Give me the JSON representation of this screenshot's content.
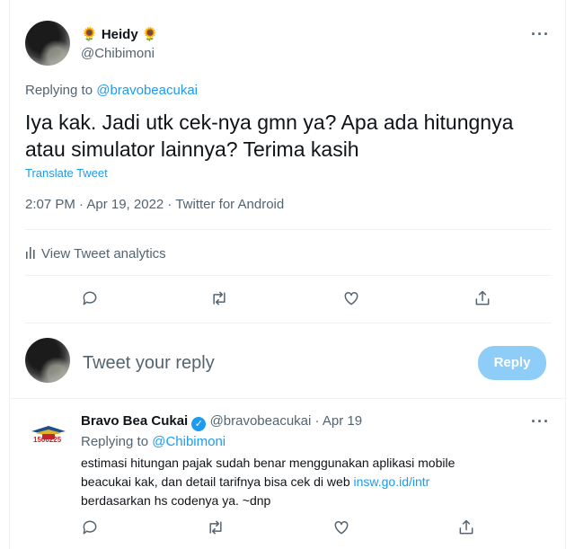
{
  "main_tweet": {
    "display_name": "🌻 Heidy 🌻",
    "handle": "@Chibimoni",
    "replying_prefix": "Replying to",
    "replying_handle": "@bravobeacukai",
    "text": "Iya kak. Jadi utk cek-nya gmn ya? Apa ada hitungnya atau simulator lainnya? Terima kasih",
    "translate_label": "Translate Tweet",
    "meta": "2:07 PM · Apr 19, 2022 · Twitter for Android",
    "analytics_label": "View Tweet analytics",
    "more_label": "···"
  },
  "composer": {
    "placeholder": "Tweet your reply",
    "reply_button": "Reply"
  },
  "reply_tweet": {
    "display_name": "Bravo Bea Cukai",
    "handle": "@bravobeacukai",
    "separator": "·",
    "date": "Apr 19",
    "replying_prefix": "Replying to",
    "replying_handle": "@Chibimoni",
    "text_line1": "estimasi hitungan pajak sudah benar menggunakan aplikasi mobile",
    "text_line2_prefix": "beacukai kak, dan detail tarifnya bisa cek di web ",
    "link": "insw.go.id/intr",
    "text_line3": "berdasarkan hs codenya ya. ~dnp",
    "logo_text": "1500225",
    "more_label": "···"
  },
  "colors": {
    "accent": "#1d9bf0",
    "reply_button_disabled": "#8ecdf8",
    "secondary_text": "#536471"
  },
  "icons": [
    "reply-icon",
    "retweet-icon",
    "like-icon",
    "share-icon",
    "analytics-icon",
    "verified-badge-icon",
    "more-icon"
  ]
}
